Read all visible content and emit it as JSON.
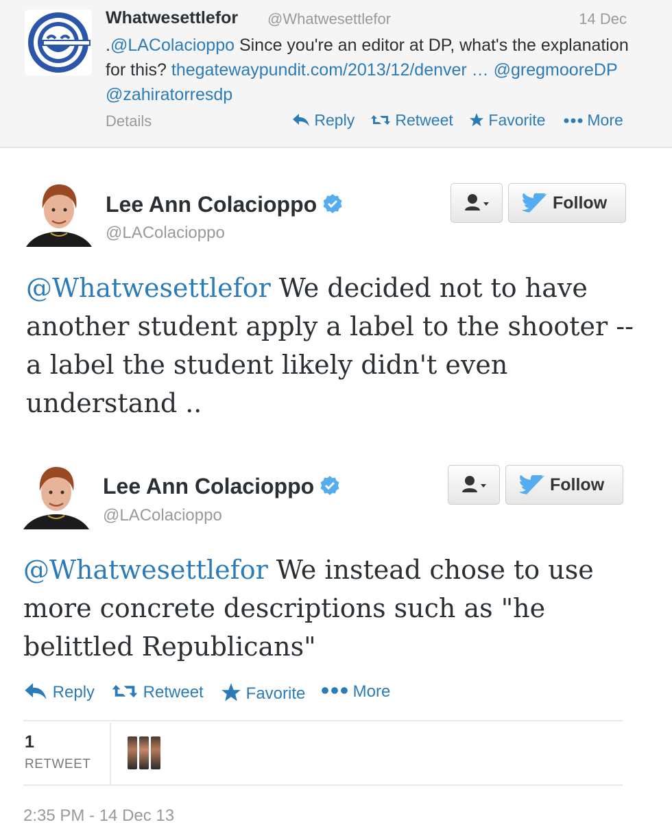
{
  "top_tweet": {
    "name": "Whatwesettlefor",
    "handle": "@Whatwesettlefor",
    "date": "14 Dec",
    "text_prefix": ".",
    "mention": "@LAColacioppo",
    "text_middle": " Since you're an editor at DP, what's the explanation for this? ",
    "url": "thegatewaypundit.com/2013/12/denver …",
    "mention2": "@gregmooreDP",
    "mention3": "@zahiratorresdp",
    "details": "Details",
    "actions": {
      "reply": "Reply",
      "retweet": "Retweet",
      "favorite": "Favorite",
      "more": "More"
    }
  },
  "tweet1": {
    "name": "Lee Ann Colacioppo",
    "handle": "@LAColacioppo",
    "follow": "Follow",
    "mention": "@Whatwesettlefor",
    "text": " We decided not to have another student apply a label to the shooter -- a label the student likely didn't even understand .."
  },
  "tweet2": {
    "name": "Lee Ann Colacioppo",
    "handle": "@LAColacioppo",
    "follow": "Follow",
    "mention": "@Whatwesettlefor",
    "text": " We instead chose to use more concrete descriptions such as \"he belittled Republicans\"",
    "actions": {
      "reply": "Reply",
      "retweet": "Retweet",
      "favorite": "Favorite",
      "more": "More"
    },
    "retweet_count": "1",
    "retweet_label": "RETWEET",
    "timestamp": "2:35 PM - 14 Dec 13"
  },
  "colors": {
    "link": "#2b7bb9",
    "verified": "#55acee",
    "twitter_blue": "#55acee"
  }
}
